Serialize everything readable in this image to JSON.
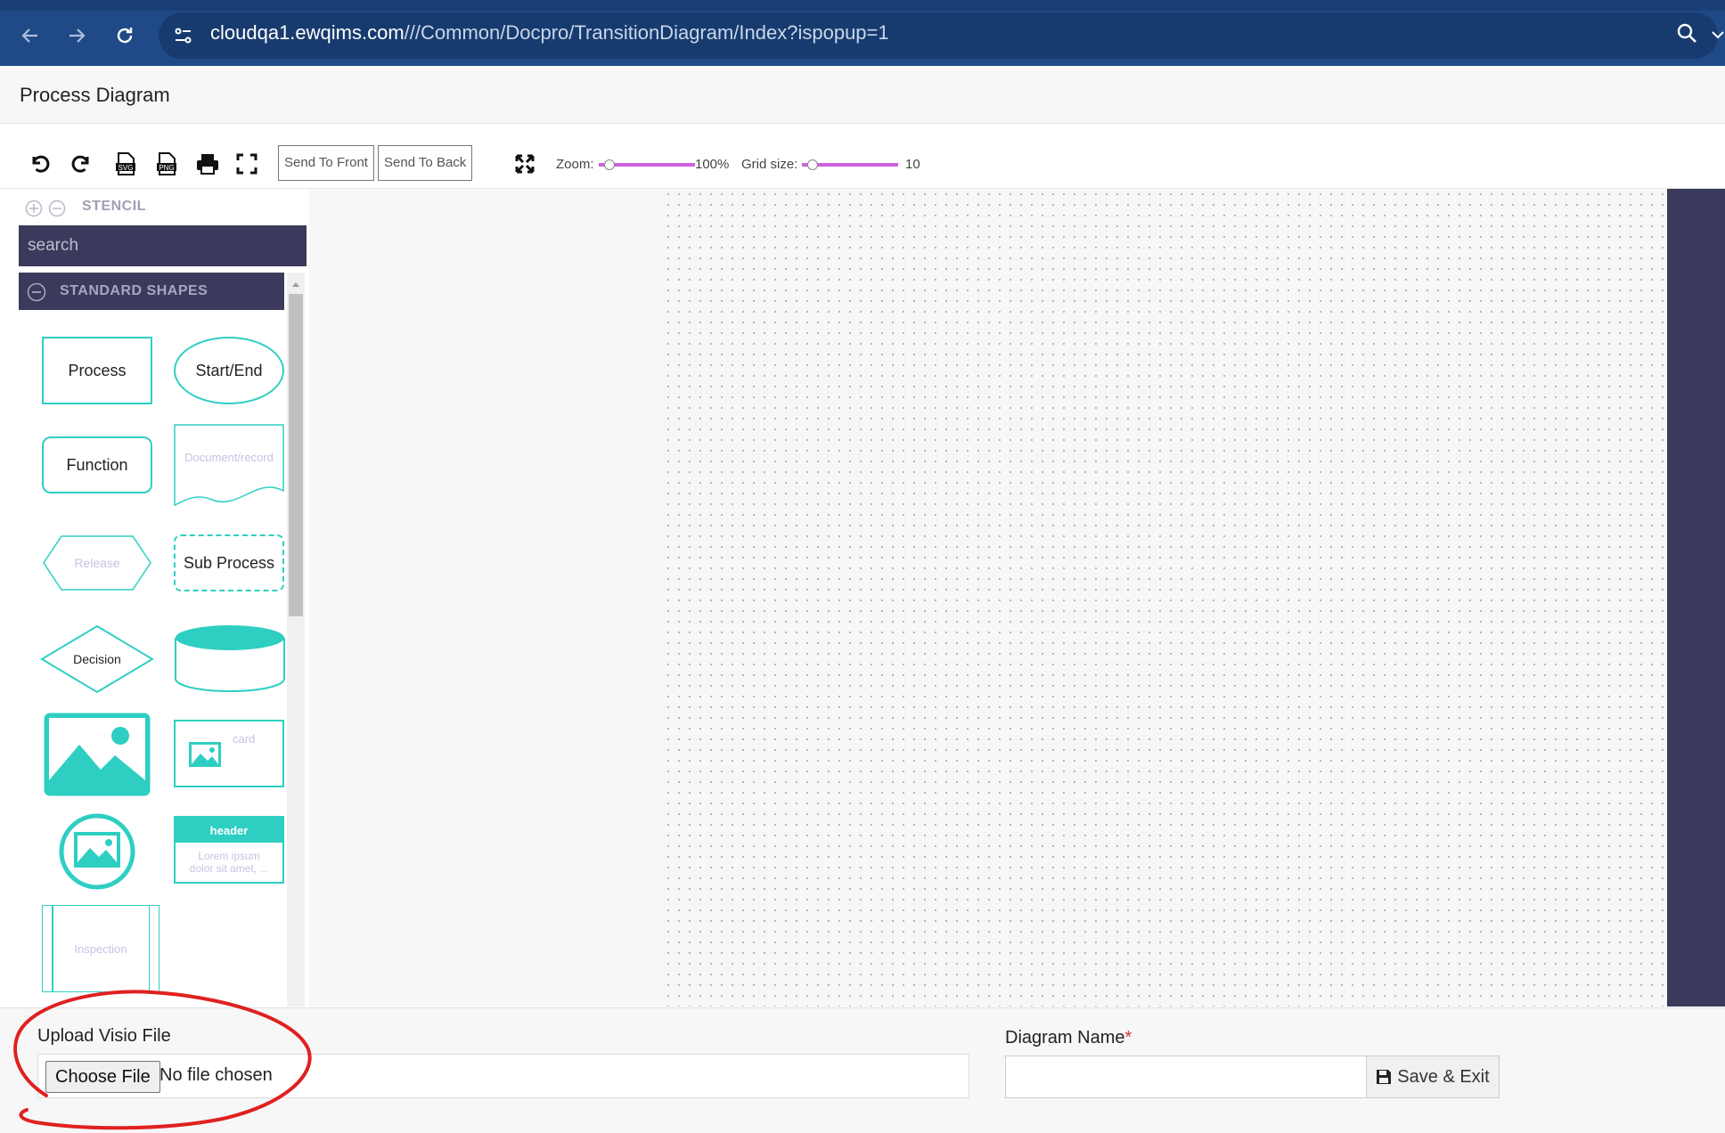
{
  "browser": {
    "url_host": "cloudqa1.ewqims.com",
    "url_path": "///Common/Docpro/TransitionDiagram/Index?ispopup=1"
  },
  "header": {
    "title": "Process Diagram"
  },
  "toolbar": {
    "icons": [
      "undo-icon",
      "redo-icon",
      "export-svg-icon",
      "export-png-icon",
      "print-icon",
      "fullscreen-icon",
      "fit-to-screen-icon"
    ],
    "svg_badge": "SVG",
    "png_badge": "PNG",
    "send_to_front": "Send To Front",
    "send_to_back": "Send To Back",
    "zoom_label": "Zoom:",
    "zoom_value": "100%",
    "zoom_level": 0.1,
    "grid_label": "Grid size:",
    "grid_value": "10",
    "grid_level": 0.1
  },
  "stencil": {
    "title": "STENCIL",
    "search_placeholder": "search",
    "group_title": "STANDARD SHAPES",
    "shapes": {
      "process": "Process",
      "start_end": "Start/End",
      "function": "Function",
      "document_record": "Document/record",
      "release": "Release",
      "sub_process": "Sub Process",
      "decision": "Decision",
      "card": "card",
      "header": "header",
      "lorem_line1": "Lorem ipsum",
      "lorem_line2": "dolor sit amet, ...",
      "inspection": "Inspection"
    }
  },
  "bottom": {
    "upload_label": "Upload Visio File",
    "choose_file": "Choose File",
    "no_file": "No file chosen",
    "diagram_name_label": "Diagram Name",
    "required_mark": "*",
    "save_exit": "Save & Exit"
  },
  "colors": {
    "accent": "#2ecfc2",
    "browser_bar": "#1f4a87",
    "panel_dark": "#3c3a5c",
    "slider": "#d060e0",
    "annotation": "#e02020"
  }
}
